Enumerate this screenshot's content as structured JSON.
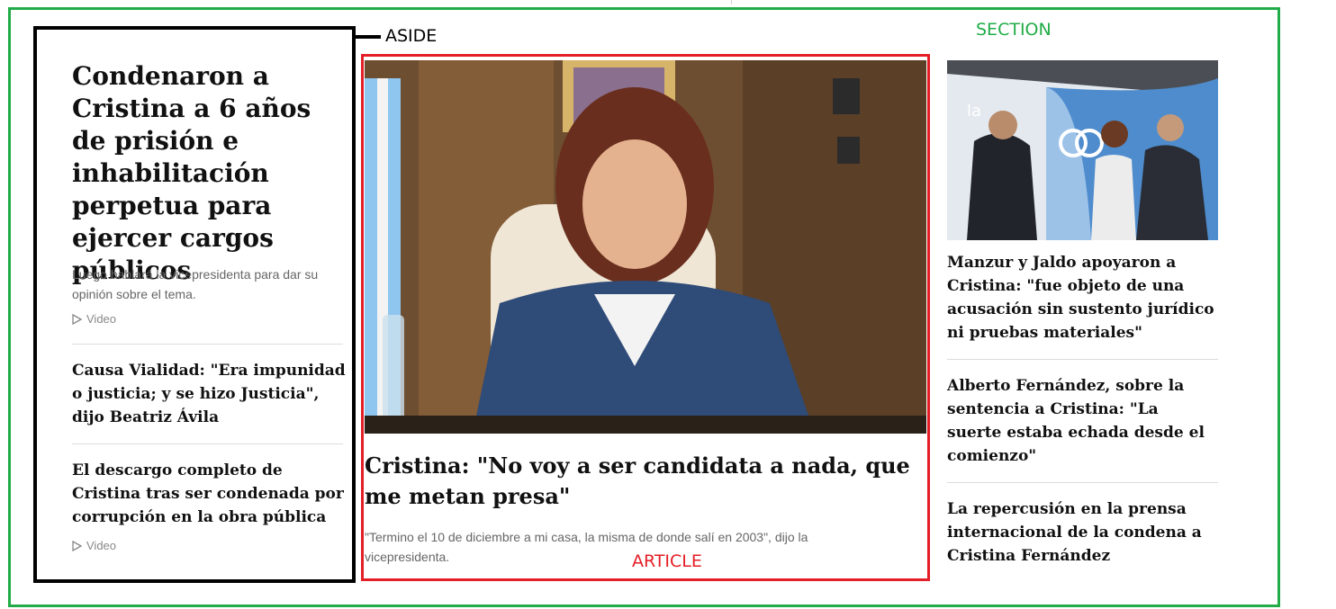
{
  "annotations": {
    "section_label": "SECTION",
    "aside_label": "ASIDE",
    "article_label": "ARTICLE",
    "colors": {
      "section": "#22ac48",
      "aside": "#000000",
      "article": "#e41e26"
    }
  },
  "aside": {
    "headline": "Condenaron a Cristina a 6 años de prisión e inhabilitación perpetua para ejercer cargos públicos",
    "summary": "Luego hablará la vicepresidenta para dar su opinión sobre el tema.",
    "video_label": "Video",
    "items": [
      {
        "title": "Causa Vialidad: \"Era impunidad o justicia; y se hizo Justicia\", dijo Beatriz Ávila"
      },
      {
        "title": "El descargo completo de Cristina tras ser condenada por corrupción en la obra pública",
        "video_label": "Video"
      }
    ]
  },
  "article": {
    "image_icon": "photo-cristina-speech",
    "headline": "Cristina: \"No voy a ser candidata a nada, que me metan presa\"",
    "summary": "\"Termino el 10 de diciembre a mi casa, la misma de donde salí en 2003\", dijo la vicepresidenta."
  },
  "section": {
    "image_icon": "photo-officials-event",
    "image_text": "la",
    "items": [
      {
        "title": "Manzur y Jaldo apoyaron a Cristina: \"fue objeto de una acusación sin sustento jurídico ni pruebas materiales\""
      },
      {
        "title": "Alberto Fernández, sobre la sentencia a Cristina: \"La suerte estaba echada desde el comienzo\""
      },
      {
        "title": "La repercusión en la prensa internacional de la condena a Cristina Fernández"
      }
    ]
  }
}
